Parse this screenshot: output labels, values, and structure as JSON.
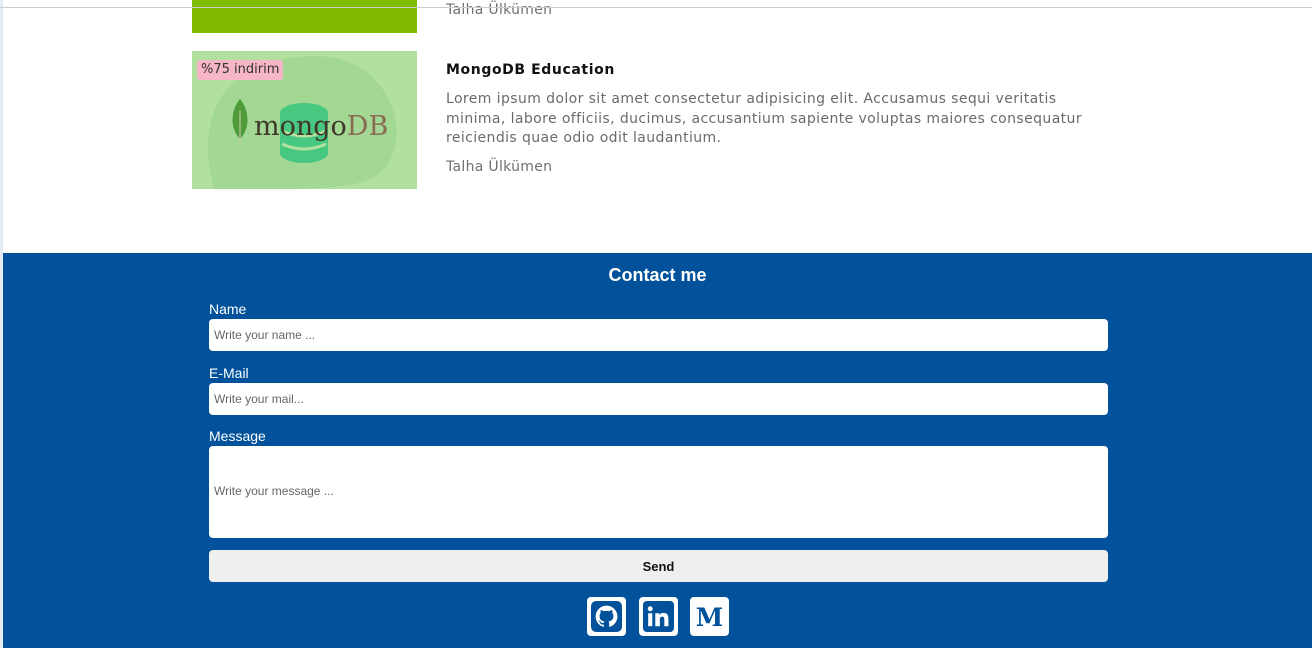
{
  "colors": {
    "footer_bg": "#01519b",
    "prev_thumb": "#80bb00",
    "course_thumb_bg": "#b2e09e",
    "badge_bg": "#f6b6c8",
    "mongo_green": "#47c881",
    "mongo_leaf": "#4f9a3b",
    "mongo_text": "#3f3529"
  },
  "previous_course": {
    "author": "Talha Ülkümen"
  },
  "course": {
    "badge": "%75 indirim",
    "logo_text": "mongoDB",
    "title": "MongoDB Education",
    "description": "Lorem ipsum dolor sit amet consectetur adipisicing elit. Accusamus sequi veritatis minima, labore officiis, ducimus, accusantium sapiente voluptas maiores consequatur reiciendis quae odio odit laudantium.",
    "author": "Talha Ülkümen"
  },
  "contact": {
    "title": "Contact me",
    "name_label": "Name",
    "name_placeholder": "Write your name ...",
    "email_label": "E-Mail",
    "email_placeholder": "Write your mail...",
    "message_label": "Message",
    "message_placeholder": "Write your message ...",
    "send_label": "Send"
  },
  "social_icons": [
    "github-icon",
    "linkedin-icon",
    "medium-icon"
  ]
}
